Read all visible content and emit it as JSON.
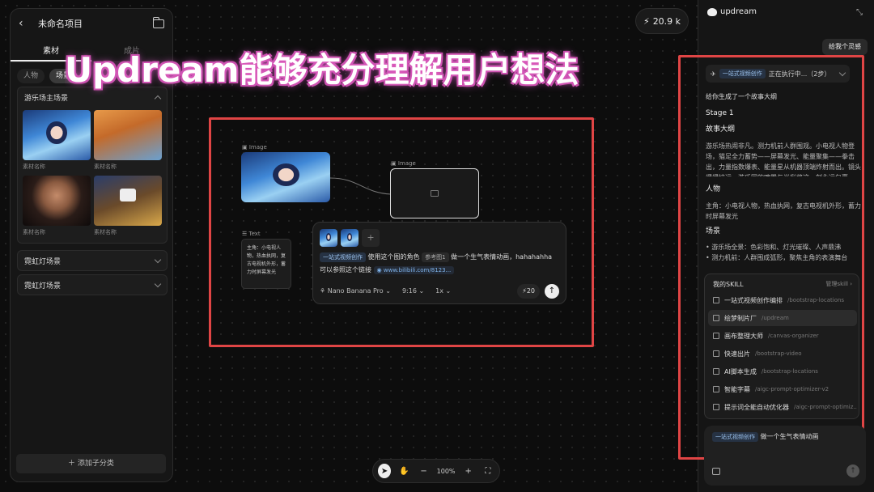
{
  "project": {
    "title": "未命名项目"
  },
  "left_panel": {
    "tabs": [
      "素材",
      "成片"
    ],
    "chips": [
      "人物",
      "场景"
    ],
    "categories": [
      {
        "name": "游乐场主场景",
        "items": [
          "素材名称",
          "素材名称",
          "素材名称",
          "素材名称"
        ]
      },
      {
        "name": "霓虹灯场景"
      },
      {
        "name": "霓虹灯场景"
      }
    ],
    "add_label": "添加子分类"
  },
  "credits": {
    "icon": "lightning-icon",
    "value": "20.9 k"
  },
  "banner": {
    "text": "Updream能够充分理解用户想法"
  },
  "canvas": {
    "image_node_label": "Image",
    "image_node2_label": "Image",
    "text_node_label": "Text",
    "text_node_content": "主角：小电视人物，热血执网，复古电视机外形，蓄力时屏幕发光",
    "prompt": {
      "skill_tag": "一站式视频创作",
      "text1": "使用这个图的角色",
      "ref_tag": "参考图1",
      "text2": "做一个生气表情动画，hahahahha",
      "text3": "可以参照这个链接",
      "link": "www.bilibili.com/8123...",
      "model": "Nano Banana Pro",
      "ratio": "9:16",
      "count": "1x",
      "cost": "20"
    }
  },
  "toolbar": {
    "zoom": "100%"
  },
  "right_panel": {
    "logo": "updream",
    "user_message": "给我个灵感",
    "status_tag": "一站式视频创作",
    "status_text": "正在执行中...（2步）",
    "reply_intro": "给你生成了一个故事大纲",
    "stage": "Stage 1",
    "sec1_title": "故事大纲",
    "sec1_body": "游乐场热闹非凡。测力机前人群围观。小电视人物登场，猫足全力蓄势——屏幕发光、能量聚集——拳击出，力量指数爆表、能量星从机器顶端炸射而出。镜头缓缓拉远，游乐园的喧嚣与光彩将这一刻永远包裹。",
    "sec2_title": "人物",
    "sec2_body": "主角：小电视人物，热血执网，复古电视机外形，蓄力时屏幕发光",
    "sec3_title": "场景",
    "sec3_items": [
      "游乐场全景：色彩饱和、灯光璀璨、人声鼎沸",
      "测力机前：人群围成弧形，聚焦主角的表演舞台"
    ],
    "skills": {
      "title": "我的SKILL",
      "manage": "管理skill",
      "items": [
        {
          "name": "一站式视频创作编排",
          "path": "/bootstrap-locations"
        },
        {
          "name": "绘梦制片厂",
          "path": "/updream"
        },
        {
          "name": "画布整理大师",
          "path": "/canvas-organizer"
        },
        {
          "name": "快速出片",
          "path": "/bootstrap-video"
        },
        {
          "name": "AI脚本生成",
          "path": "/bootstrap-locations"
        },
        {
          "name": "智能字幕",
          "path": "/aigc-prompt-optimizer-v2"
        },
        {
          "name": "提示词全能自动优化器",
          "path": "/aigc-prompt-optimiz..."
        }
      ]
    },
    "composer": {
      "tag": "一站式视频创作",
      "text": "做一个生气表情动画"
    }
  },
  "colors": {
    "highlight_box": "#e04545",
    "banner_glow": "#d55bc5"
  }
}
